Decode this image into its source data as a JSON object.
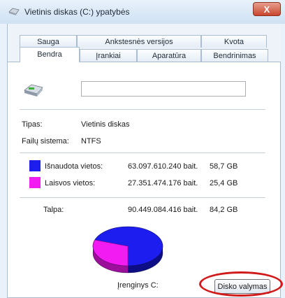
{
  "window": {
    "title": "Vietinis diskas (C:) ypatybės",
    "close_glyph": "X"
  },
  "tabs_back": [
    "Sauga",
    "Ankstesnės versijos",
    "Kvota"
  ],
  "tabs_front": [
    "Bendra",
    "Įrankiai",
    "Aparatūra",
    "Bendrinimas"
  ],
  "general": {
    "name_value": "",
    "type_label": "Tipas:",
    "type_value": "Vietinis diskas",
    "fs_label": "Failų sistema:",
    "fs_value": "NTFS"
  },
  "space": {
    "used": {
      "label": "Išnaudota vietos:",
      "bytes": "63.097.610.240 bait.",
      "size": "58,7 GB",
      "color": "#1d1df0"
    },
    "free": {
      "label": "Laisvos vietos:",
      "bytes": "27.351.474.176 bait.",
      "size": "25,4 GB",
      "color": "#f21cf2"
    },
    "total": {
      "label": "Talpa:",
      "bytes": "90.449.084.416 bait.",
      "size": "84,2 GB"
    }
  },
  "pie": {
    "used_fraction": 0.698,
    "free_fraction": 0.302
  },
  "disk": {
    "label": "Įrenginys C:"
  },
  "buttons": {
    "cleanup": "Disko valymas"
  },
  "icons": {
    "window": "drive-window-icon",
    "drive": "hard-drive-icon",
    "close": "close-icon"
  }
}
